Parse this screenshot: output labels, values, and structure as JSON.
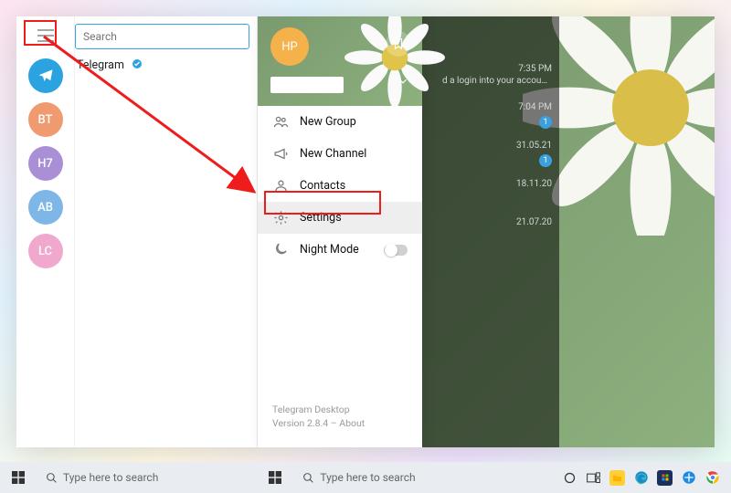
{
  "search": {
    "placeholder": "Search"
  },
  "rail": {
    "items": [
      {
        "label": "",
        "class": "tg"
      },
      {
        "label": "BT",
        "class": "c-bt"
      },
      {
        "label": "H7",
        "class": "c-h7"
      },
      {
        "label": "AB",
        "class": "c-ab"
      },
      {
        "label": "LC",
        "class": "c-lc"
      }
    ]
  },
  "chat": {
    "name": "Telegram"
  },
  "menu": {
    "avatar_label": "HP",
    "items": [
      {
        "label": "New Group"
      },
      {
        "label": "New Channel"
      },
      {
        "label": "Contacts"
      },
      {
        "label": "Settings"
      },
      {
        "label": "Night Mode"
      }
    ],
    "footer_line1": "Telegram Desktop",
    "footer_line2": "Version 2.8.4 – About"
  },
  "dim_rows": [
    {
      "time": "7:35 PM",
      "snippet": "d a login into your account f…",
      "badge": ""
    },
    {
      "time": "7:04 PM",
      "snippet": "",
      "badge": "1"
    },
    {
      "time": "31.05.21",
      "snippet": "",
      "badge": "1"
    },
    {
      "time": "18.11.20",
      "snippet": "",
      "badge": ""
    },
    {
      "time": "21.07.20",
      "snippet": "",
      "badge": ""
    }
  ],
  "taskbar": {
    "search_placeholder": "Type here to search"
  }
}
